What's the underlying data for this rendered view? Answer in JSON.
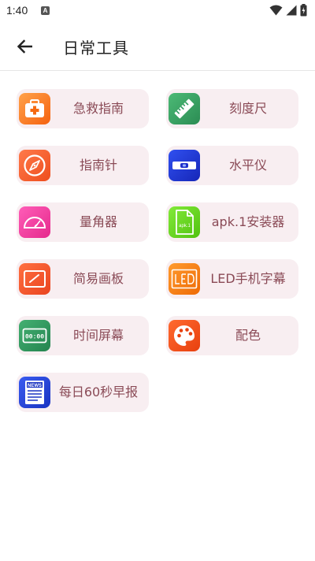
{
  "status": {
    "time": "1:40",
    "notif_letter": "A"
  },
  "header": {
    "title": "日常工具"
  },
  "tools": [
    {
      "label": "急救指南",
      "icon": "first-aid-kit-icon",
      "color": "#f77c1d"
    },
    {
      "label": "刻度尺",
      "icon": "ruler-icon",
      "color": "#3aa463"
    },
    {
      "label": "指南针",
      "icon": "compass-icon",
      "color": "#f2602f"
    },
    {
      "label": "水平仪",
      "icon": "spirit-level-icon",
      "color": "#2036d6"
    },
    {
      "label": "量角器",
      "icon": "protractor-icon",
      "color": "#f23ea0"
    },
    {
      "label": "apk.1安装器",
      "icon": "apk-file-icon",
      "color": "#67d61f",
      "icon_text": "apk.1"
    },
    {
      "label": "简易画板",
      "icon": "drawing-board-icon",
      "color": "#f2532b"
    },
    {
      "label": "LED手机字幕",
      "icon": "led-marquee-icon",
      "color": "#f27b12"
    },
    {
      "label": "时间屏幕",
      "icon": "clock-screen-icon",
      "color": "#2e9a5e",
      "icon_text": "00:00"
    },
    {
      "label": "配色",
      "icon": "palette-icon",
      "color": "#f24f1e"
    },
    {
      "label": "每日60秒早报",
      "icon": "news-icon",
      "color": "#2040cf",
      "icon_text": "NEWS"
    }
  ]
}
